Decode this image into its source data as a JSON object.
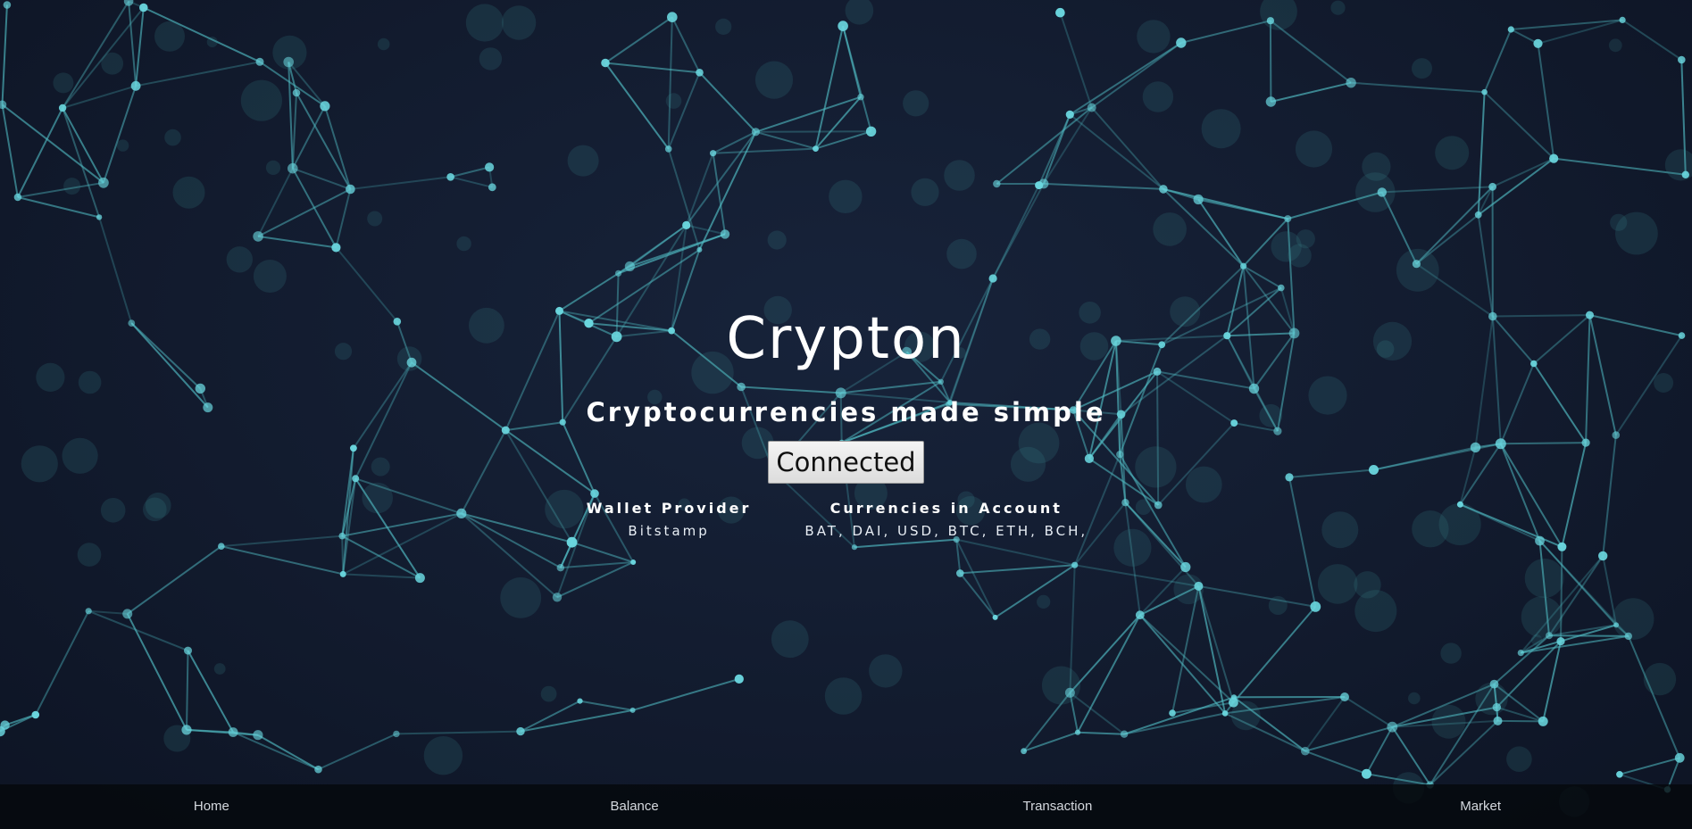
{
  "hero": {
    "title": "Crypton",
    "tagline": "Cryptocurrencies made simple",
    "connect_button": "Connected"
  },
  "wallet": {
    "provider_label": "Wallet Provider",
    "provider_value": "Bitstamp",
    "currencies_label": "Currencies in Account",
    "currencies_value": "BAT, DAI, USD, BTC, ETH, BCH,"
  },
  "nav": {
    "items": [
      {
        "label": "Home"
      },
      {
        "label": "Balance"
      },
      {
        "label": "Transaction"
      },
      {
        "label": "Market"
      }
    ]
  },
  "colors": {
    "background": "#121b2e",
    "network_node": "#5fd0d8",
    "text": "#ffffff",
    "navbar": "#05080c"
  }
}
